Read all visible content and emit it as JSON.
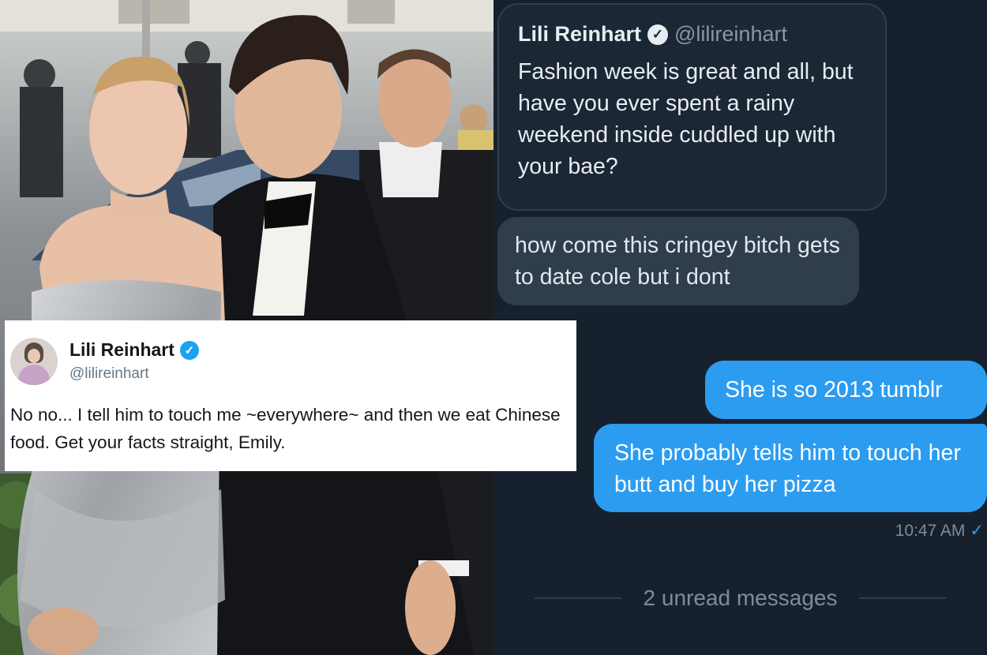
{
  "dm_panel": {
    "quoted_tweet": {
      "name": "Lili Reinhart",
      "handle": "@lilireinhart",
      "text": "Fashion week is great and all, but have you ever spent a rainy weekend inside cuddled up with your bae?",
      "verified_icon": "verified-badge-icon"
    },
    "incoming_message": "how come this cringey bitch gets to date cole but i dont",
    "outgoing_messages": [
      "She is so 2013 tumblr",
      "She probably tells him to touch her butt and buy her pizza"
    ],
    "timestamp": "10:47 AM",
    "timestamp_icon": "check-icon",
    "unread_divider": "2 unread messages"
  },
  "tweet_card": {
    "name": "Lili Reinhart",
    "handle": "@lilireinhart",
    "text": "No no... I tell him to touch me ~everywhere~ and then we eat Chinese food. Get your facts straight, Emily.",
    "verified_icon": "verified-badge-icon"
  },
  "colors": {
    "dm_background": "#17212d",
    "outgoing_bubble": "#2c9cf0",
    "incoming_bubble": "#2f3d4c",
    "twitter_blue": "#1da1f2"
  }
}
